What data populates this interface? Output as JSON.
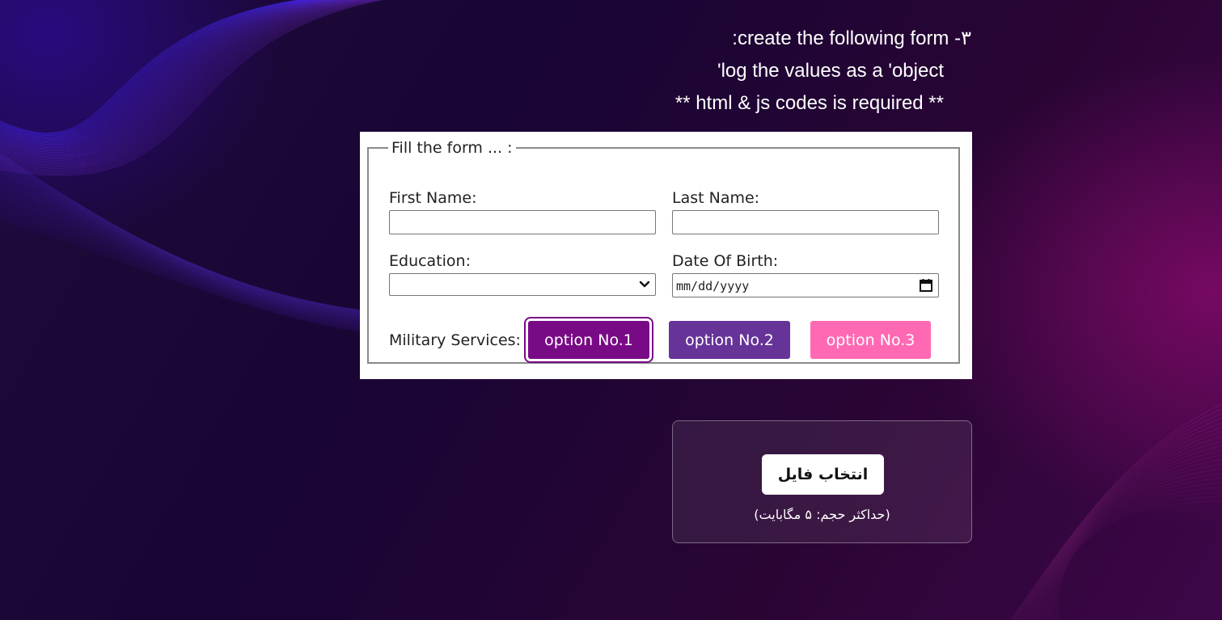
{
  "instructions": {
    "line1": "۳- create the following form:",
    "line2": "log the values as a 'object'",
    "line3": "** html & js codes is required **"
  },
  "form": {
    "legend": "Fill the form ... :",
    "first_name_label": "First Name:",
    "first_name_value": "",
    "last_name_label": "Last Name:",
    "last_name_value": "",
    "education_label": "Education:",
    "education_selected": "",
    "dob_label": "Date Of Birth:",
    "dob_placeholder": "mm/dd/yyyy",
    "military_label": "Military Services:",
    "options": [
      {
        "label": "option No.1",
        "color": "#790a86"
      },
      {
        "label": "option No.2",
        "color": "#663399"
      },
      {
        "label": "option No.3",
        "color": "#ff69b4"
      }
    ]
  },
  "upload": {
    "button_label": "انتخاب فایل",
    "hint": "(حداکثر حجم: ۵ مگابایت)"
  },
  "colors": {
    "accent_purple": "#790a86",
    "rebecca_purple": "#663399",
    "hot_pink": "#ff69b4"
  },
  "icons": {
    "select_chevron": "chevron-down-icon",
    "date_picker": "calendar-icon"
  }
}
